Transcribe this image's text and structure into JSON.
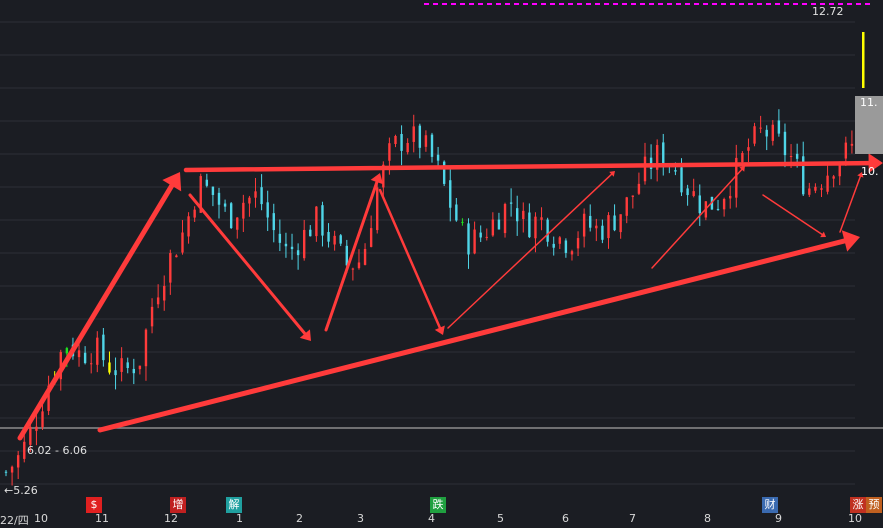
{
  "chart_data": {
    "type": "candlestick",
    "title": "",
    "ylim": [
      5.0,
      13.0
    ],
    "price_labels": {
      "high": "12.72",
      "low": "←5.26",
      "range": "6.02 - 6.06",
      "right_box": "11.",
      "right_mid": "10."
    },
    "x_ticks": [
      "22/四",
      "10",
      "11",
      "12",
      "1",
      "2",
      "3",
      "4",
      "5",
      "6",
      "7",
      "8",
      "9",
      "10"
    ],
    "event_markers": [
      {
        "label": "$",
        "color": "#e02020"
      },
      {
        "label": "增",
        "color": "#c02020"
      },
      {
        "label": "解",
        "color": "#20a0a0"
      },
      {
        "label": "跌",
        "color": "#20a040"
      },
      {
        "label": "财",
        "color": "#3a6ab0"
      },
      {
        "label": "涨",
        "color": "#c03020"
      },
      {
        "label": "预",
        "color": "#c06020"
      }
    ],
    "close_path": [
      5.3,
      5.6,
      6.2,
      6.9,
      7.5,
      7.3,
      7.4,
      7.1,
      7.0,
      7.2,
      8.3,
      8.9,
      9.4,
      10.2,
      10.0,
      9.6,
      9.9,
      10.0,
      9.4,
      9.0,
      9.3,
      9.6,
      9.2,
      8.8,
      8.9,
      10.1,
      10.8,
      11.0,
      10.9,
      10.5,
      9.8,
      9.2,
      9.3,
      9.6,
      9.9,
      9.5,
      9.6,
      9.3,
      9.2,
      9.5,
      9.4,
      9.6,
      9.9,
      10.4,
      10.7,
      10.5,
      10.1,
      9.8,
      9.9,
      10.3,
      10.8,
      11.1,
      10.9,
      10.6,
      10.1,
      10.3,
      10.6,
      10.8
    ],
    "support_level": 6.05,
    "colors": {
      "up": "#ff3b3b",
      "down": "#4fd6e8",
      "arrow": "#ff3b3b",
      "support": "#8c8c8c",
      "magenta": "#ff00ff",
      "yellow": "#ffff00",
      "green": "#20e020"
    }
  }
}
